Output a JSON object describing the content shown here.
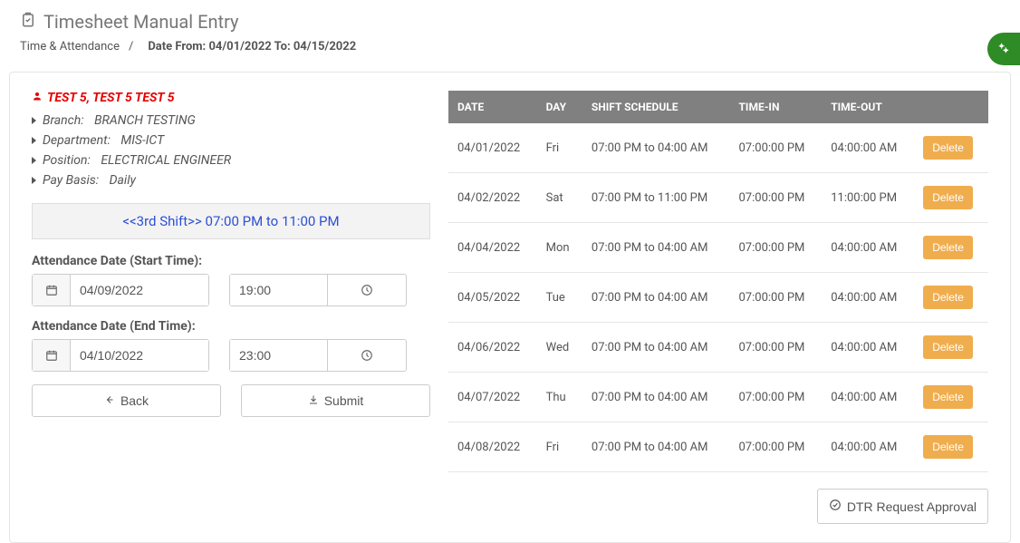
{
  "page_title": "Timesheet Manual Entry",
  "breadcrumb": {
    "root": "Time & Attendance",
    "sep": "/",
    "current": "Date From: 04/01/2022 To: 04/15/2022"
  },
  "employee": {
    "name": "TEST 5, TEST 5 TEST 5",
    "branch_label": "Branch:",
    "branch": "BRANCH TESTING",
    "department_label": "Department:",
    "department": "MIS-ICT",
    "position_label": "Position:",
    "position": "ELECTRICAL ENGINEER",
    "paybasis_label": "Pay Basis:",
    "paybasis": "Daily"
  },
  "shift_banner": "<<3rd Shift>> 07:00 PM to 11:00 PM",
  "form": {
    "start_label": "Attendance Date (Start Time):",
    "start_date": "04/09/2022",
    "start_time": "19:00",
    "end_label": "Attendance Date (End Time):",
    "end_date": "04/10/2022",
    "end_time": "23:00",
    "back_label": "Back",
    "submit_label": "Submit"
  },
  "table": {
    "headers": {
      "date": "DATE",
      "day": "DAY",
      "shift": "SHIFT SCHEDULE",
      "timein": "TIME-IN",
      "timeout": "TIME-OUT",
      "action": ""
    },
    "delete_label": "Delete",
    "rows": [
      {
        "date": "04/01/2022",
        "day": "Fri",
        "shift": "07:00 PM to 04:00 AM",
        "in": "07:00:00 PM",
        "out": "04:00:00 AM"
      },
      {
        "date": "04/02/2022",
        "day": "Sat",
        "shift": "07:00 PM to 11:00 PM",
        "in": "07:00:00 PM",
        "out": "11:00:00 PM"
      },
      {
        "date": "04/04/2022",
        "day": "Mon",
        "shift": "07:00 PM to 04:00 AM",
        "in": "07:00:00 PM",
        "out": "04:00:00 AM"
      },
      {
        "date": "04/05/2022",
        "day": "Tue",
        "shift": "07:00 PM to 04:00 AM",
        "in": "07:00:00 PM",
        "out": "04:00:00 AM"
      },
      {
        "date": "04/06/2022",
        "day": "Wed",
        "shift": "07:00 PM to 04:00 AM",
        "in": "07:00:00 PM",
        "out": "04:00:00 AM"
      },
      {
        "date": "04/07/2022",
        "day": "Thu",
        "shift": "07:00 PM to 04:00 AM",
        "in": "07:00:00 PM",
        "out": "04:00:00 AM"
      },
      {
        "date": "04/08/2022",
        "day": "Fri",
        "shift": "07:00 PM to 04:00 AM",
        "in": "07:00:00 PM",
        "out": "04:00:00 AM"
      }
    ]
  },
  "footer": {
    "approval_label": "DTR Request Approval"
  }
}
